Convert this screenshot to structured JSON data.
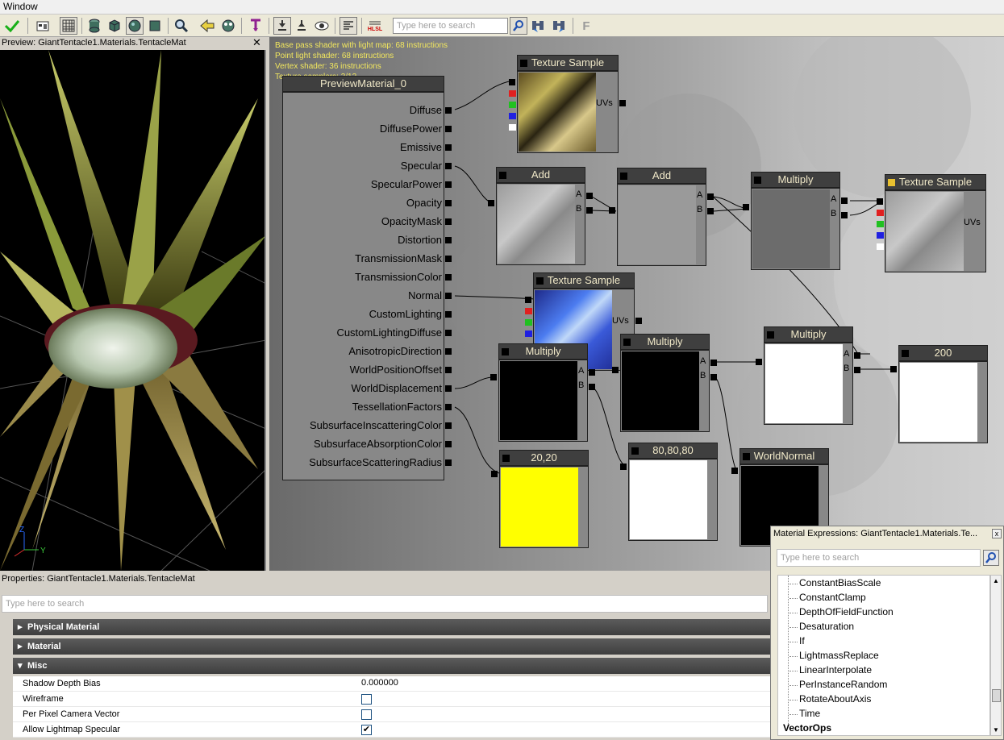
{
  "menubar": {
    "window": "Window"
  },
  "toolbar": {
    "search_placeholder": "Type here to search",
    "hlsl_label": "HLSL",
    "f_label": "F",
    "icons": [
      "apply-check-icon",
      "home-view-icon",
      "grid-icon",
      "cylinder-icon",
      "cube-icon",
      "sphere-icon",
      "plane-icon",
      "find-icon",
      "back-arrow-icon",
      "realtime-icon",
      "place-node-icon",
      "connectors-icon",
      "hide-icon",
      "eye-icon",
      "stats-icon",
      "hlsl-icon",
      "search-icon",
      "binoculars-left-icon",
      "binoculars-right-icon",
      "f-icon"
    ]
  },
  "preview": {
    "title": "Preview: GiantTentacle1.Materials.TentacleMat",
    "close": "✕",
    "axis": {
      "z": "Z",
      "y": "Y"
    }
  },
  "stats": [
    "Base pass shader with light map: 68 instructions",
    "Point light shader: 68 instructions",
    "Vertex shader: 36 instructions",
    "Texture samplers: 3/12"
  ],
  "material_node": {
    "title": "PreviewMaterial_0",
    "inputs": [
      "Diffuse",
      "DiffusePower",
      "Emissive",
      "Specular",
      "SpecularPower",
      "Opacity",
      "OpacityMask",
      "Distortion",
      "TransmissionMask",
      "TransmissionColor",
      "Normal",
      "CustomLighting",
      "CustomLightingDiffuse",
      "AnisotropicDirection",
      "WorldPositionOffset",
      "WorldDisplacement",
      "TessellationFactors",
      "SubsurfaceInscatteringColor",
      "SubsurfaceAbsorptionColor",
      "SubsurfaceScatteringRadius"
    ]
  },
  "nodes": {
    "tex1": "Texture Sample",
    "add1": "Add",
    "add2": "Add",
    "mult1": "Multiply",
    "tex_right": "Texture Sample",
    "tex2": "Texture Sample",
    "mult2": "Multiply",
    "mult3": "Multiply",
    "mult4": "Multiply",
    "const200": "200",
    "vec2020": "20,20",
    "vec808080": "80,80,80",
    "worldnormal": "WorldNormal"
  },
  "pins": {
    "a": "A",
    "b": "B",
    "uvs": "UVs"
  },
  "properties": {
    "title": "Properties: GiantTentacle1.Materials.TentacleMat",
    "search_placeholder": "Type here to search",
    "categories": [
      "Physical Material",
      "Material",
      "Misc"
    ],
    "rows": [
      {
        "name": "Shadow Depth Bias",
        "value": "0.000000"
      },
      {
        "name": "Wireframe",
        "checked": false
      },
      {
        "name": "Per Pixel Camera Vector",
        "checked": false
      },
      {
        "name": "Allow Lightmap Specular",
        "checked": true,
        "check_mark": "✔"
      }
    ]
  },
  "expressions": {
    "title": "Material Expressions: GiantTentacle1.Materials.Te...",
    "close": "x",
    "search_placeholder": "Type here to search",
    "items": [
      "ConstantBiasScale",
      "ConstantClamp",
      "DepthOfFieldFunction",
      "Desaturation",
      "If",
      "LightmassReplace",
      "LinearInterpolate",
      "PerInstanceRandom",
      "RotateAboutAxis",
      "Time"
    ],
    "group": "VectorOps"
  }
}
